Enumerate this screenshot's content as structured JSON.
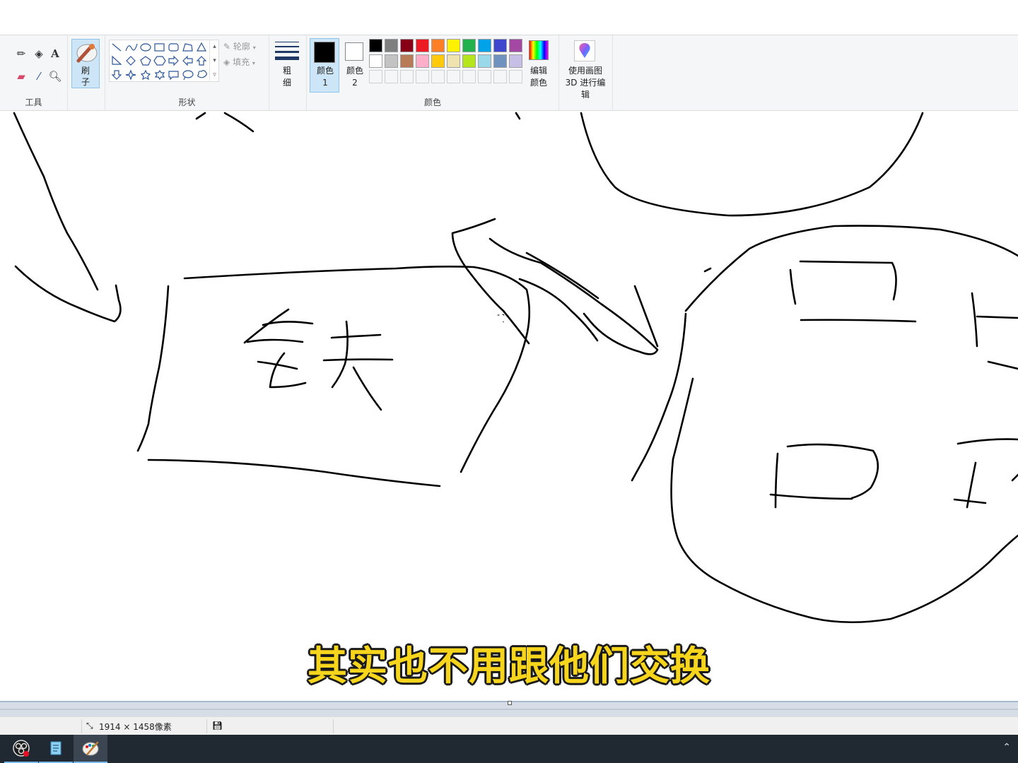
{
  "ribbon": {
    "groups": {
      "tools_label": "工具",
      "shapes_label": "形状",
      "colors_label": "颜色"
    },
    "brush_label": "刷子",
    "outline_label": "轮廓",
    "fill_label": "填充",
    "size_label": "粗细",
    "color1_label": "颜色 1",
    "color2_label": "颜色 2",
    "edit_colors_label": "编辑颜色",
    "paint3d_label": "使用画图 3D 进行编辑",
    "color1": "#000000",
    "color2": "#ffffff",
    "palette_row1": [
      "#000000",
      "#7f7f7f",
      "#880015",
      "#ed1c24",
      "#ff7f27",
      "#fff200",
      "#22b14c",
      "#00a2e8",
      "#3f48cc",
      "#a349a4"
    ],
    "palette_row2": [
      "#ffffff",
      "#c3c3c3",
      "#b97a57",
      "#ffaec9",
      "#ffc90e",
      "#efe4b0",
      "#b5e61d",
      "#99d9ea",
      "#7092be",
      "#c8bfe7"
    ],
    "shape_icons": [
      "line-icon",
      "curve-icon",
      "oval-icon",
      "rectangle-icon",
      "rounded-rectangle-icon",
      "polygon-icon",
      "triangle-icon",
      "right-triangle-icon",
      "diamond-icon",
      "pentagon-icon",
      "hexagon-icon",
      "right-arrow-icon",
      "left-arrow-icon",
      "up-arrow-icon",
      "down-arrow-icon",
      "four-point-star-icon",
      "five-point-star-icon",
      "six-point-star-icon",
      "rounded-callout-icon",
      "oval-callout-icon",
      "cloud-callout-icon"
    ]
  },
  "canvas": {
    "handwriting": "铁",
    "subtitle": "其实也不用跟他们交换"
  },
  "statusbar": {
    "dimensions": "1914 × 1458像素"
  },
  "taskbar": {
    "apps": [
      "obs-icon",
      "notepad-icon",
      "paint-icon"
    ]
  }
}
